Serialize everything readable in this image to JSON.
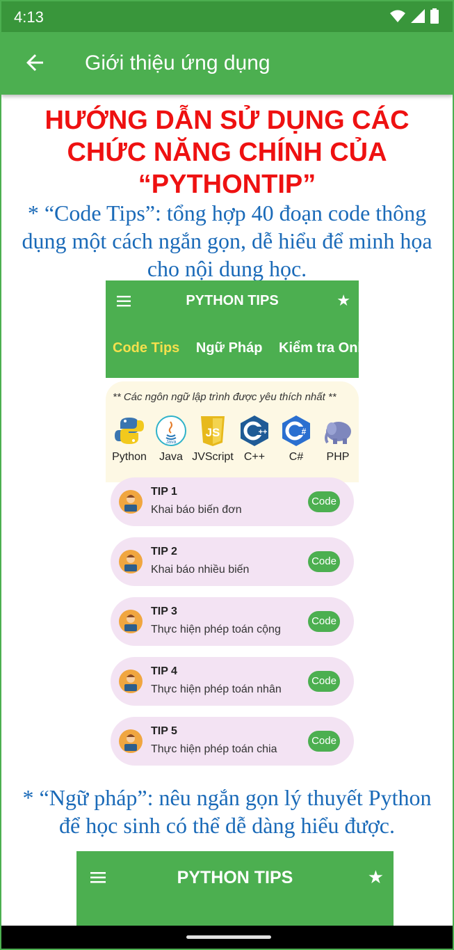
{
  "status_bar": {
    "time": "4:13",
    "icons": [
      "wifi-icon",
      "signal-icon",
      "battery-icon"
    ]
  },
  "app_bar": {
    "title": "Giới thiệu ứng dụng",
    "back_icon": "arrow-left-icon"
  },
  "content": {
    "heading_lines": [
      "HƯỚNG DẪN SỬ DỤNG CÁC",
      "CHỨC NĂNG CHÍNH CỦA",
      "“PYTHONTIP”"
    ],
    "para1_lines": [
      "* “Code Tips”: tổng hợp 40 đoạn code thông",
      "dụng một cách ngắn gọn, dễ hiểu để minh họa",
      "cho nội dung học."
    ],
    "para2_lines": [
      "* “Ngữ pháp”: nêu ngắn gọn lý thuyết Python",
      "để học sinh có thể dễ dàng hiểu được."
    ]
  },
  "screenshot1": {
    "title": "PYTHON TIPS",
    "tabs": [
      "Code Tips",
      "Ngữ Pháp",
      "Kiểm tra Online"
    ],
    "card_caption": "** Các ngôn ngữ lập trình được yêu thích nhất **",
    "languages": [
      "Python",
      "Java",
      "JVScript",
      "C++",
      "C#",
      "PHP"
    ],
    "tips": [
      {
        "number": "TIP 1",
        "desc": "Khai báo biến đơn",
        "button": "Code"
      },
      {
        "number": "TIP 2",
        "desc": "Khai báo nhiều biến",
        "button": "Code"
      },
      {
        "number": "TIP 3",
        "desc": "Thực hiện phép toán cộng",
        "button": "Code"
      },
      {
        "number": "TIP 4",
        "desc": "Thực hiện phép toán nhân",
        "button": "Code"
      },
      {
        "number": "TIP 5",
        "desc": "Thực hiện phép toán chia",
        "button": "Code"
      }
    ]
  },
  "screenshot2": {
    "title": "PYTHON TIPS"
  },
  "colors": {
    "green": "#4caf50",
    "dark_green": "#39963b",
    "red_heading": "#ee1111",
    "blue_text": "#1a6ab8",
    "tip_bg": "#f3e3f3",
    "active_tab": "#f4e04d"
  }
}
